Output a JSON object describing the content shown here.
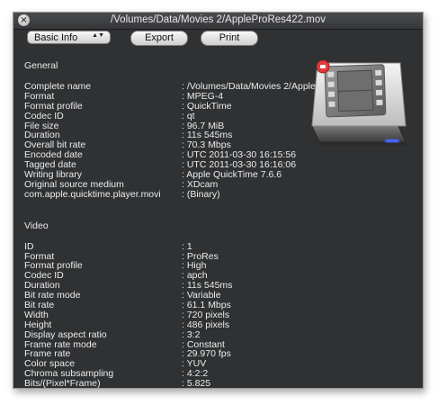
{
  "window": {
    "title": "/Volumes/Data/Movies 2/AppleProRes422.mov",
    "close_glyph": "×"
  },
  "toolbar": {
    "view_select": "Basic Info",
    "view_select_arrows": "▲▼",
    "export_label": "Export",
    "print_label": "Print"
  },
  "general": {
    "title": "General",
    "rows": [
      {
        "label": "Complete name",
        "value": ": /Volumes/Data/Movies 2/AppleProRes422.mov"
      },
      {
        "label": "Format",
        "value": ": MPEG-4"
      },
      {
        "label": "Format profile",
        "value": ": QuickTime"
      },
      {
        "label": "Codec ID",
        "value": ": qt"
      },
      {
        "label": "File size",
        "value": ": 96.7 MiB"
      },
      {
        "label": "Duration",
        "value": ": 11s 545ms"
      },
      {
        "label": "Overall bit rate",
        "value": ": 70.3 Mbps"
      },
      {
        "label": "Encoded date",
        "value": ": UTC 2011-03-30 16:15:56"
      },
      {
        "label": "Tagged date",
        "value": ": UTC 2011-03-30 16:16:06"
      },
      {
        "label": "Writing library",
        "value": ": Apple QuickTime 7.6.6"
      },
      {
        "label": "Original source medium",
        "value": ": XDcam"
      },
      {
        "label": "com.apple.quicktime.player.movi",
        "value": ": (Binary)"
      }
    ]
  },
  "video": {
    "title": "Video",
    "rows": [
      {
        "label": "ID",
        "value": ": 1"
      },
      {
        "label": "Format",
        "value": ": ProRes"
      },
      {
        "label": "Format profile",
        "value": ": High"
      },
      {
        "label": "Codec ID",
        "value": ": apch"
      },
      {
        "label": "Duration",
        "value": ": 11s 545ms"
      },
      {
        "label": "Bit rate mode",
        "value": ": Variable"
      },
      {
        "label": "Bit rate",
        "value": ": 61.1 Mbps"
      },
      {
        "label": "Width",
        "value": ": 720 pixels"
      },
      {
        "label": "Height",
        "value": ": 486 pixels"
      },
      {
        "label": "Display aspect ratio",
        "value": ": 3:2"
      },
      {
        "label": "Frame rate mode",
        "value": ": Constant"
      },
      {
        "label": "Frame rate",
        "value": ": 29.970 fps"
      },
      {
        "label": "Color space",
        "value": ": YUV"
      },
      {
        "label": "Chroma subsampling",
        "value": ": 4:2:2"
      },
      {
        "label": "Bits/(Pixel*Frame)",
        "value": ": 5.825"
      }
    ]
  },
  "icons": {
    "drive": "film-drive-icon"
  },
  "colors": {
    "window_bg": "#2f3133",
    "text": "#ececec",
    "drive_led": "#4a63ff"
  }
}
